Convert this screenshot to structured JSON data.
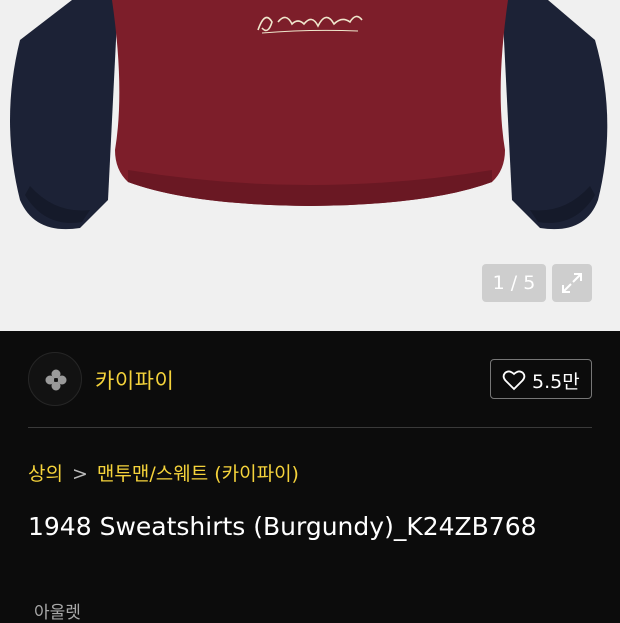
{
  "gallery": {
    "product_image": "burgundy-navy-sweatshirt",
    "counter": "1 / 5",
    "expand_icon": "expand-arrows-icon"
  },
  "brand": {
    "logo_icon": "clover-icon",
    "name": "카이파이"
  },
  "like": {
    "icon": "heart-outline-icon",
    "count": "5.5만"
  },
  "breadcrumb": {
    "category": "상의",
    "separator": ">",
    "subcategory": "맨투맨/스웨트 (카이파이)"
  },
  "product": {
    "title": "1948 Sweatshirts (Burgundy)_K24ZB768"
  },
  "seller_label": "아울렛",
  "colors": {
    "accent": "#f5d33b",
    "background": "#0c0c0c",
    "body": "#7d1e2a",
    "sleeve": "#1c2236"
  }
}
